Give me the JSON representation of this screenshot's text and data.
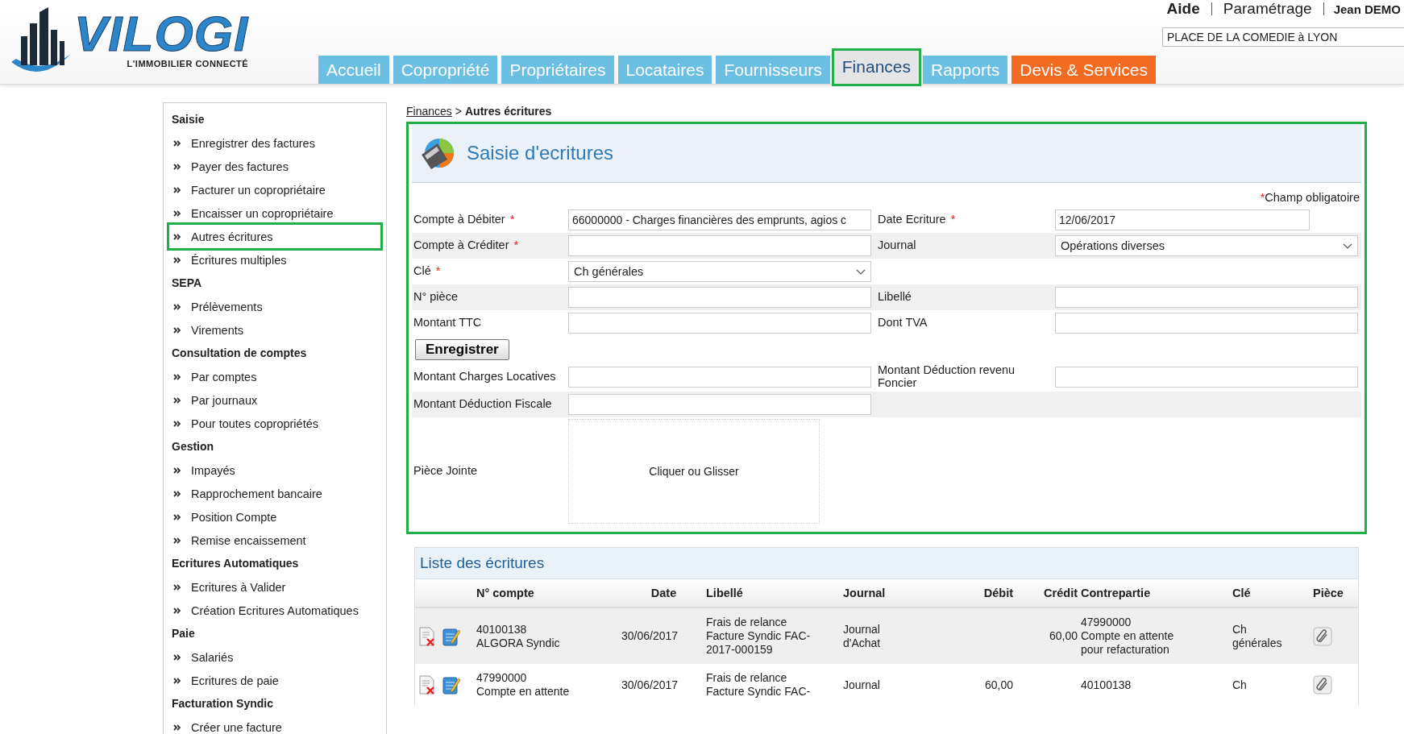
{
  "header": {
    "logo_text": "VILOGI",
    "logo_tagline": "L'IMMOBILIER CONNECTÉ",
    "links": [
      "Aide",
      "Paramétrage"
    ],
    "user": "Jean DEMO",
    "property": "PLACE DE LA COMEDIE à LYON"
  },
  "tabs": [
    {
      "label": "Accueil",
      "selected": false,
      "kind": "normal"
    },
    {
      "label": "Copropriété",
      "selected": false,
      "kind": "normal"
    },
    {
      "label": "Propriétaires",
      "selected": false,
      "kind": "normal"
    },
    {
      "label": "Locataires",
      "selected": false,
      "kind": "normal"
    },
    {
      "label": "Fournisseurs",
      "selected": false,
      "kind": "normal"
    },
    {
      "label": "Finances",
      "selected": true,
      "kind": "normal"
    },
    {
      "label": "Rapports",
      "selected": false,
      "kind": "normal"
    },
    {
      "label": "Devis & Services",
      "selected": false,
      "kind": "promo"
    }
  ],
  "sidebar": {
    "sections": [
      {
        "title": "Saisie",
        "items": [
          {
            "label": "Enregistrer des factures",
            "selected": false
          },
          {
            "label": "Payer des factures",
            "selected": false
          },
          {
            "label": "Facturer un copropriétaire",
            "selected": false
          },
          {
            "label": "Encaisser un copropriétaire",
            "selected": false
          },
          {
            "label": "Autres écritures",
            "selected": true
          },
          {
            "label": "Écritures multiples",
            "selected": false
          }
        ]
      },
      {
        "title": "SEPA",
        "items": [
          {
            "label": "Prélèvements",
            "selected": false
          },
          {
            "label": "Virements",
            "selected": false
          }
        ]
      },
      {
        "title": "Consultation de comptes",
        "items": [
          {
            "label": "Par comptes",
            "selected": false
          },
          {
            "label": "Par journaux",
            "selected": false
          },
          {
            "label": "Pour toutes copropriétés",
            "selected": false
          }
        ]
      },
      {
        "title": "Gestion",
        "items": [
          {
            "label": "Impayés",
            "selected": false
          },
          {
            "label": "Rapprochement bancaire",
            "selected": false
          },
          {
            "label": "Position Compte",
            "selected": false
          },
          {
            "label": "Remise encaissement",
            "selected": false
          }
        ]
      },
      {
        "title": "Ecritures Automatiques",
        "items": [
          {
            "label": "Ecritures à Valider",
            "selected": false
          },
          {
            "label": "Création Ecritures Automatiques",
            "selected": false
          }
        ]
      },
      {
        "title": "Paie",
        "items": [
          {
            "label": "Salariés",
            "selected": false
          },
          {
            "label": "Ecritures de paie",
            "selected": false
          }
        ]
      },
      {
        "title": "Facturation Syndic",
        "items": [
          {
            "label": "Créer une facture",
            "selected": false
          }
        ]
      }
    ]
  },
  "breadcrumb": {
    "link": "Finances",
    "separator": ">",
    "current": "Autres écritures"
  },
  "form": {
    "title": "Saisie d'ecritures",
    "note_mark": "*",
    "note": "Champ obligatoire",
    "rows": [
      [
        {
          "label": "Compte à Débiter",
          "required_mark": "*",
          "kind": "text",
          "value": "66000000 - Charges financières des emprunts, agios c"
        },
        {
          "label": "Date Ecriture",
          "required_mark": "*",
          "kind": "date",
          "value": "12/06/2017"
        }
      ],
      [
        {
          "label": "Compte à Créditer",
          "required_mark": "*",
          "kind": "text"
        },
        {
          "label": "Journal",
          "kind": "select",
          "value": "Opérations diverses"
        }
      ],
      [
        {
          "label": "Clé",
          "required_mark": "*",
          "kind": "select",
          "value": "Ch générales"
        }
      ],
      [
        {
          "label": "N° pièce",
          "kind": "text"
        },
        {
          "label": "Libellé",
          "kind": "text"
        }
      ],
      [
        {
          "label": "Montant TTC",
          "kind": "text"
        },
        {
          "label": "Dont TVA",
          "kind": "text"
        }
      ]
    ],
    "button": "Enregistrer",
    "extra_rows": [
      [
        {
          "label": "Montant Charges Locatives",
          "kind": "text"
        },
        {
          "label": "Montant Déduction revenu Foncier",
          "kind": "text"
        }
      ],
      [
        {
          "label": "Montant Déduction Fiscale",
          "kind": "text"
        }
      ]
    ],
    "attachment": {
      "label": "Pièce Jointe",
      "dropzone": "Cliquer ou Glisser"
    }
  },
  "list": {
    "title": "Liste des écritures",
    "columns": [
      "N° compte",
      "Date",
      "Libellé",
      "Journal",
      "Débit",
      "Crédit",
      "Contrepartie",
      "Clé",
      "Pièce"
    ],
    "rows": [
      {
        "account": [
          "40100138",
          "ALGORA Syndic"
        ],
        "date": "30/06/2017",
        "label": [
          "Frais de relance",
          "Facture Syndic FAC-",
          "2017-000159"
        ],
        "journal": [
          "Journal",
          "d'Achat"
        ],
        "credit": "60,00",
        "counterpart": [
          "47990000",
          "Compte en attente",
          "pour refacturation"
        ],
        "key": [
          "Ch",
          "générales"
        ]
      },
      {
        "account": [
          "47990000",
          "Compte en attente"
        ],
        "date": "30/06/2017",
        "label": [
          "Frais de relance",
          "Facture Syndic FAC-"
        ],
        "journal": [
          "Journal"
        ],
        "debit": "60,00",
        "counterpart": [
          "40100138"
        ],
        "key": [
          "Ch"
        ]
      }
    ]
  }
}
